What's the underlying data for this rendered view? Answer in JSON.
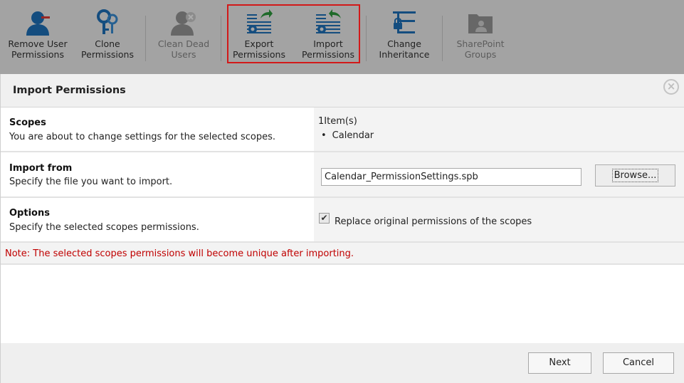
{
  "ribbon": {
    "items": [
      {
        "label": "Remove User\nPermissions",
        "icon": "remove-user-icon",
        "enabled": true
      },
      {
        "label": "Clone\nPermissions",
        "icon": "clone-permissions-icon",
        "enabled": true
      },
      {
        "label": "Clean Dead\nUsers",
        "icon": "clean-dead-users-icon",
        "enabled": false
      },
      {
        "label": "Export\nPermissions",
        "icon": "export-permissions-icon",
        "enabled": true
      },
      {
        "label": "Import\nPermissions",
        "icon": "import-permissions-icon",
        "enabled": true
      },
      {
        "label": "Change\nInheritance",
        "icon": "change-inheritance-icon",
        "enabled": true
      },
      {
        "label": "SharePoint\nGroups",
        "icon": "sharepoint-groups-icon",
        "enabled": false
      }
    ],
    "highlight_color": "#d21919",
    "accent_color": "#1e73be"
  },
  "dialog": {
    "title": "Import Permissions",
    "close_icon": "close-icon",
    "scopes": {
      "title": "Scopes",
      "description": "You are about to change settings for the selected scopes.",
      "count": "1Item(s)",
      "items": [
        "Calendar"
      ]
    },
    "import_from": {
      "title": "Import from",
      "description": "Specify the file you want to import.",
      "file_value": "Calendar_PermissionSettings.spb",
      "browse_label": "Browse..."
    },
    "options": {
      "title": "Options",
      "description": "Specify the selected scopes permissions.",
      "replace_label": "Replace original permissions of the scopes",
      "replace_checked": true
    },
    "note": "Note: The selected scopes permissions will become unique after importing.",
    "note_color": "#c00000",
    "buttons": {
      "next": "Next",
      "cancel": "Cancel"
    }
  }
}
